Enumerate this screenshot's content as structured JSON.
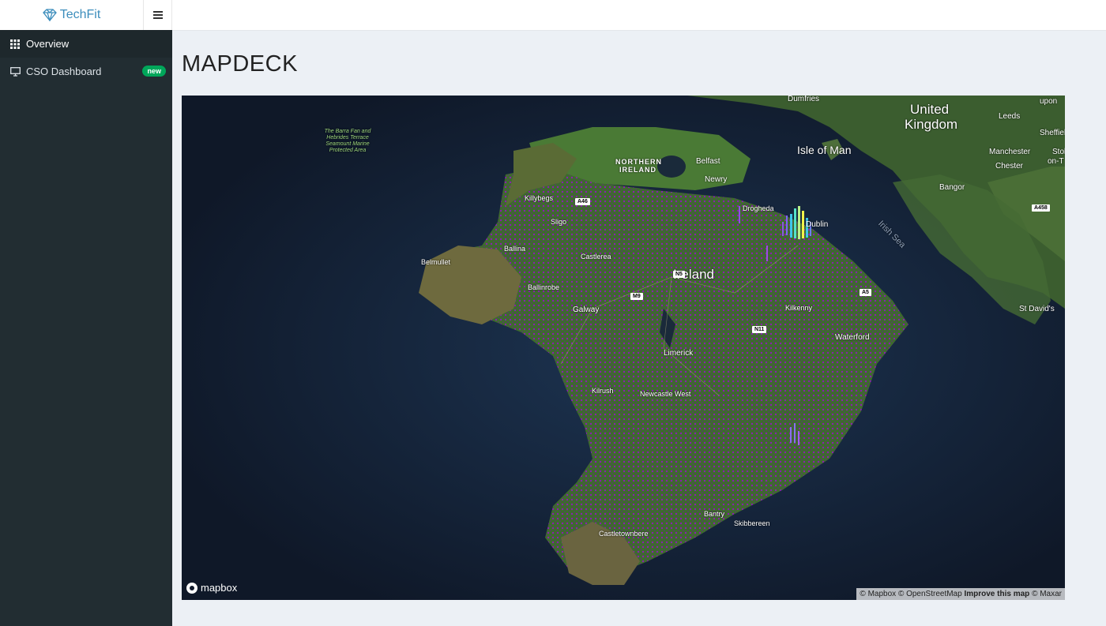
{
  "app": {
    "name": "TechFit",
    "brand_color": "#3c8dbc"
  },
  "sidebar": {
    "items": [
      {
        "label": "Overview",
        "icon": "grid-icon",
        "active": true
      },
      {
        "label": "CSO Dashboard",
        "icon": "monitor-icon",
        "badge": "new"
      }
    ]
  },
  "page": {
    "title": "MAPDECK"
  },
  "map": {
    "labels": {
      "united_kingdom_1": "United",
      "united_kingdom_2": "Kingdom",
      "isle_of_man": "Isle of Man",
      "northern_ireland_1": "NORTHERN",
      "northern_ireland_2": "IRELAND",
      "belfast": "Belfast",
      "newry": "Newry",
      "ireland": "Ireland",
      "galway": "Galway",
      "limerick": "Limerick",
      "castlerea": "Castlerea",
      "ballina": "Ballina",
      "belmullet": "Belmullet",
      "ballinrobe": "Ballinrobe",
      "sligo": "Sligo",
      "killybegs": "Killybegs",
      "kilrush": "Kilrush",
      "newcastle_west": "Newcastle West",
      "kilkenny": "Kilkenny",
      "waterford": "Waterford",
      "skibbereen": "Skibbereen",
      "bantry": "Bantry",
      "castletownbere": "Castletownbere",
      "leeds": "Leeds",
      "manchester": "Manchester",
      "chester": "Chester",
      "bangor": "Bangor",
      "sheffield": "Sheffiel",
      "stoke_1": "Stok",
      "stoke_2": "on-T",
      "dumfries": "Dumfries",
      "upon": "upon",
      "st_davids": "St David's",
      "irish_sea": "Irish Sea",
      "barra_fan": "The Barra Fan and Hebrides Terrace Seamount Marine Protected Area",
      "drogheda": "Drogheda",
      "dublin": "Dublin"
    },
    "shields": {
      "a46": "A46",
      "n5": "N5",
      "m9": "M9",
      "n11": "N11",
      "a458": "A458",
      "a5": "A5"
    },
    "logo": "mapbox",
    "attribution": {
      "mapbox": "© Mapbox",
      "osm": "© OpenStreetMap",
      "improve": "Improve this map",
      "maxar": "© Maxar"
    }
  }
}
